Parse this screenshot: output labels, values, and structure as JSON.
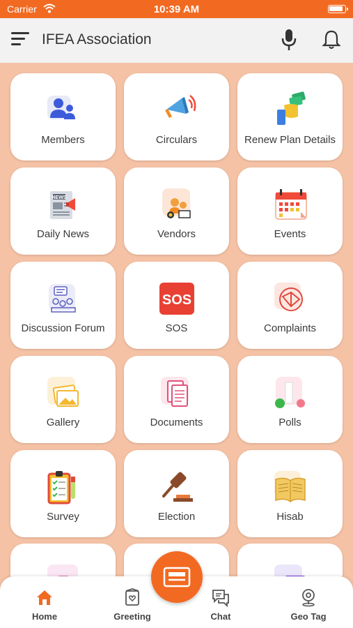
{
  "status_bar": {
    "carrier": "Carrier",
    "time": "10:39 AM"
  },
  "header": {
    "title": "IFEA Association"
  },
  "colors": {
    "accent": "#f26a22",
    "background": "#f5c2a5"
  },
  "tiles": [
    {
      "label": "Members",
      "icon": "members-icon"
    },
    {
      "label": "Circulars",
      "icon": "megaphone-icon"
    },
    {
      "label": "Renew Plan Details",
      "icon": "money-hand-icon"
    },
    {
      "label": "Daily News",
      "icon": "newspaper-icon"
    },
    {
      "label": "Vendors",
      "icon": "vendors-icon"
    },
    {
      "label": "Events",
      "icon": "calendar-icon"
    },
    {
      "label": "Discussion Forum",
      "icon": "discussion-icon"
    },
    {
      "label": "SOS",
      "icon": "sos-icon"
    },
    {
      "label": "Complaints",
      "icon": "complaint-icon"
    },
    {
      "label": "Gallery",
      "icon": "gallery-icon"
    },
    {
      "label": "Documents",
      "icon": "documents-icon"
    },
    {
      "label": "Polls",
      "icon": "polls-icon"
    },
    {
      "label": "Survey",
      "icon": "survey-icon"
    },
    {
      "label": "Election",
      "icon": "gavel-icon"
    },
    {
      "label": "Hisab",
      "icon": "book-icon"
    }
  ],
  "bottom_nav": [
    {
      "label": "Home",
      "icon": "home-icon"
    },
    {
      "label": "Greeting",
      "icon": "greeting-icon"
    },
    {
      "label": "Chat",
      "icon": "chat-icon"
    },
    {
      "label": "Geo Tag",
      "icon": "location-icon"
    }
  ]
}
